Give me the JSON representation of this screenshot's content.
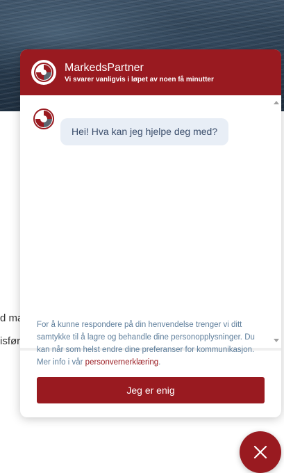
{
  "background": {
    "text_line_1": "d ma",
    "text_line_2": "isfør"
  },
  "chat": {
    "header": {
      "title": "MarkedsPartner",
      "subtitle": "Vi svarer vanligvis i løpet av noen få minutter",
      "logo_icon": "markedspartner-logo-icon"
    },
    "messages": [
      {
        "sender": "bot",
        "text": "Hei! Hva kan jeg hjelpe deg med?"
      }
    ],
    "consent": {
      "text": "For å kunne respondere på din henvendelse trenger vi ditt samtykke til å lagre og behandle dine personopplysninger. Du kan når som helst endre dine preferanser for kommunikasjon. Mer info i vår ",
      "link_label": "personvernerklæring",
      "trailing": ".",
      "button_label": "Jeg er enig"
    },
    "close_icon": "close-icon"
  },
  "colors": {
    "brand": "#991a20",
    "bubble_bg": "#e8eef6",
    "consent_text": "#5f7f9c"
  }
}
